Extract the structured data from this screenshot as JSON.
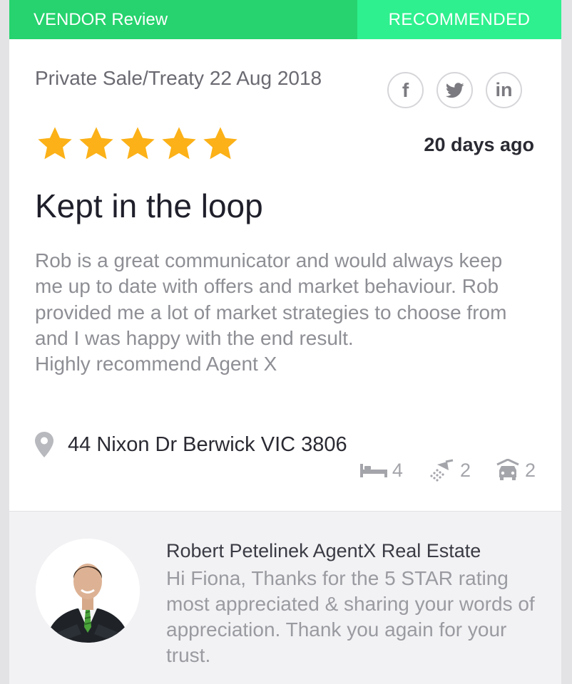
{
  "header": {
    "type_label": "VENDOR Review",
    "badge": "RECOMMENDED"
  },
  "review": {
    "sale_info": "Private Sale/Treaty 22 Aug 2018",
    "rating": 5,
    "rating_max": 5,
    "posted": "20 days ago",
    "title": "Kept in the loop",
    "body": "Rob is a great communicator and would always keep me up to date with offers and market behaviour. Rob provided me a lot of market strategies to choose from and I was happy with the end result.",
    "closing": "Highly recommend Agent X"
  },
  "social": [
    {
      "icon": "facebook-icon",
      "glyph": "f"
    },
    {
      "icon": "twitter-icon"
    },
    {
      "icon": "linkedin-icon",
      "glyph": "in"
    }
  ],
  "property": {
    "address": "44 Nixon Dr Berwick VIC 3806",
    "bedrooms": "4",
    "bathrooms": "2",
    "parking": "2"
  },
  "reply": {
    "author": "Robert Petelinek AgentX Real Estate",
    "text": "Hi Fiona, Thanks for the 5 STAR rating most appreciated & sharing your words of appreciation. Thank you again for your trust."
  },
  "colors": {
    "header_green": "#26d36e",
    "badge_green": "#2ef08e",
    "star_gold": "#fbb117"
  }
}
